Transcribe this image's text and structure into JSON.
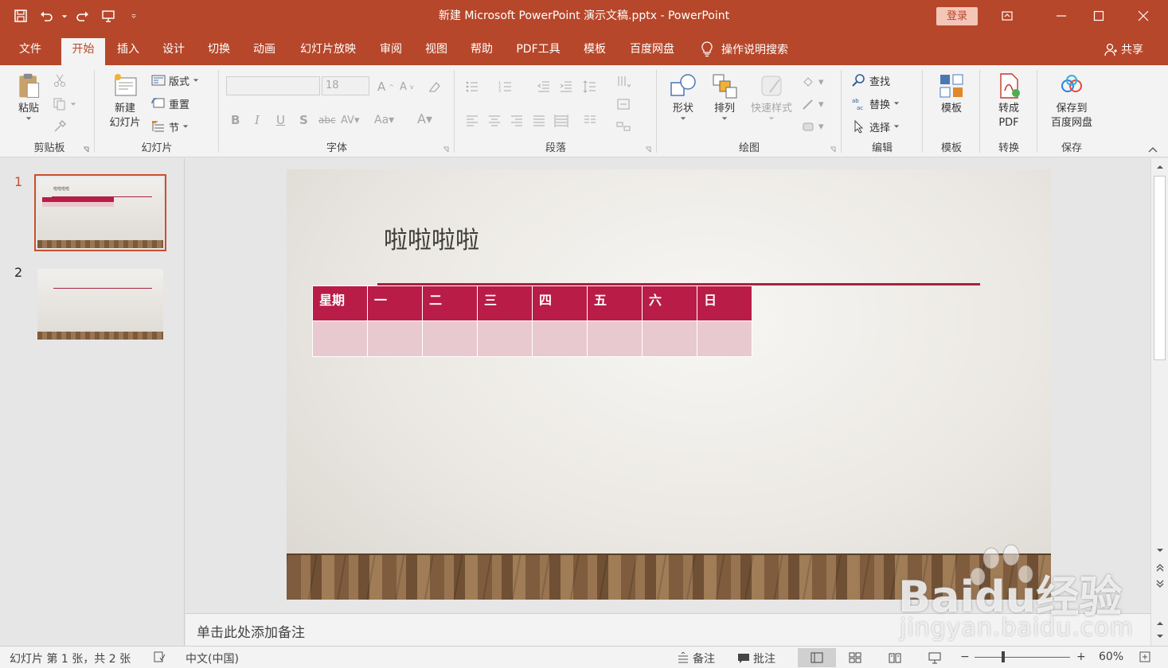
{
  "titlebar": {
    "title": "新建 Microsoft PowerPoint 演示文稿.pptx  -  PowerPoint",
    "login": "登录"
  },
  "tabs": [
    {
      "label": "文件"
    },
    {
      "label": "开始"
    },
    {
      "label": "插入"
    },
    {
      "label": "设计"
    },
    {
      "label": "切换"
    },
    {
      "label": "动画"
    },
    {
      "label": "幻灯片放映"
    },
    {
      "label": "审阅"
    },
    {
      "label": "视图"
    },
    {
      "label": "帮助"
    },
    {
      "label": "PDF工具"
    },
    {
      "label": "模板"
    },
    {
      "label": "百度网盘"
    }
  ],
  "active_tab": "开始",
  "tellme": "操作说明搜索",
  "share": "共享",
  "ribbon": {
    "clipboard": {
      "paste": "粘贴",
      "label": "剪贴板"
    },
    "slides": {
      "new_line1": "新建",
      "new_line2": "幻灯片",
      "layout": "版式",
      "reset": "重置",
      "section": "节",
      "label": "幻灯片"
    },
    "font": {
      "size": "18",
      "label": "字体"
    },
    "paragraph": {
      "label": "段落"
    },
    "drawing": {
      "shapes": "形状",
      "arrange": "排列",
      "quick_styles": "快速样式",
      "label": "绘图"
    },
    "editing": {
      "find": "查找",
      "replace": "替换",
      "select": "选择",
      "label": "编辑"
    },
    "template": {
      "btn": "模板",
      "label": "模板"
    },
    "convert": {
      "line1": "转成",
      "line2": "PDF",
      "label": "转换"
    },
    "save": {
      "line1": "保存到",
      "line2": "百度网盘",
      "label": "保存"
    }
  },
  "thumbnails": [
    {
      "num": "1",
      "title": "啦啦啦啦"
    },
    {
      "num": "2"
    }
  ],
  "slide": {
    "title": "啦啦啦啦",
    "table_headers": [
      "星期",
      "一",
      "二",
      "三",
      "四",
      "五",
      "六",
      "日"
    ]
  },
  "notes_placeholder": "单击此处添加备注",
  "status": {
    "slide_info": "幻灯片 第 1 张，共 2 张",
    "language": "中文(中国)",
    "notes": "备注",
    "comments": "批注",
    "zoom": "60%"
  },
  "watermark": {
    "brand": "Baidu经验",
    "url": "jingyan.baidu.com"
  },
  "colors": {
    "accent": "#b7472a",
    "table_header": "#b91c47",
    "table_cell": "#e8c9cf",
    "rule": "#a8213f"
  }
}
